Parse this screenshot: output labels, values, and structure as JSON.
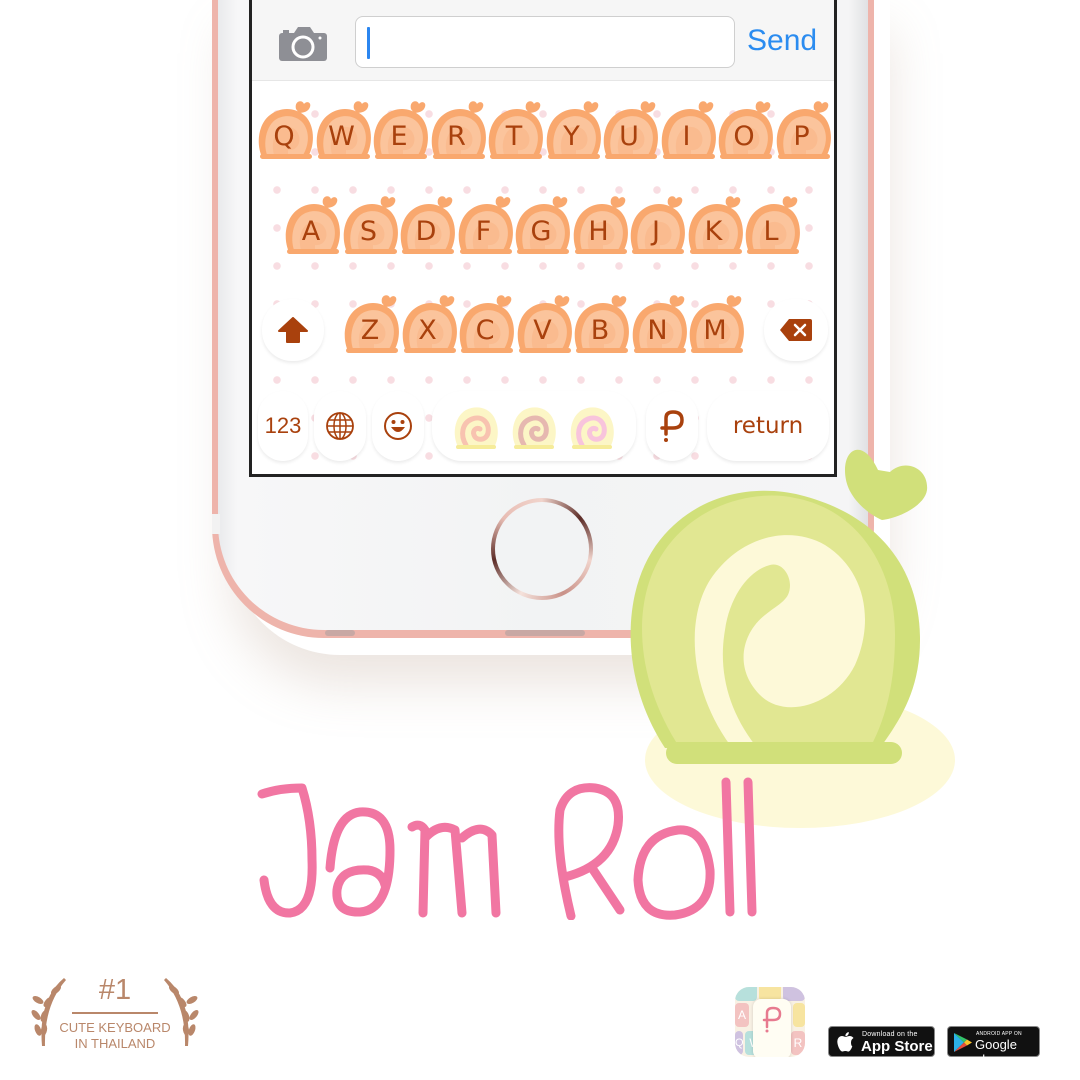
{
  "message_bar": {
    "camera_icon": "camera-icon",
    "input_value": "",
    "send_label": "Send"
  },
  "keyboard": {
    "row1": [
      "Q",
      "W",
      "E",
      "R",
      "T",
      "Y",
      "U",
      "I",
      "O",
      "P"
    ],
    "row2": [
      "A",
      "S",
      "D",
      "F",
      "G",
      "H",
      "J",
      "K",
      "L"
    ],
    "row3": [
      "Z",
      "X",
      "C",
      "V",
      "B",
      "N",
      "M"
    ],
    "shift_icon": "shift-arrow-icon",
    "backspace_icon": "backspace-icon",
    "numbers_label": "123",
    "globe_icon": "globe-icon",
    "emoji_icon": "smiley-icon",
    "theme_rolls": [
      "peach-roll",
      "chocolate-roll",
      "pink-roll"
    ],
    "logo_icon": "p-logo-icon",
    "return_label": "return",
    "colors": {
      "key_outer": "#f9a86e",
      "key_inner": "#fbc49c",
      "key_text": "#a9410d",
      "dot": "#f8dde2"
    }
  },
  "hero": {
    "title": "Jam Roll",
    "title_color": "#f176a2",
    "roll_colors": {
      "outer": "#d1e07a",
      "mid": "#e1e792",
      "cream": "#fdf9d8",
      "plate": "#fdf9d8"
    }
  },
  "badge": {
    "rank": "#1",
    "line1": "CUTE KEYBOARD",
    "line2": "IN THAILAND",
    "color": "#b9876a"
  },
  "stores": {
    "app_store_small": "Download on the",
    "app_store_big": "App Store",
    "google_small": "ANDROID APP ON",
    "google_big": "Google play"
  },
  "app_icon_letters": [
    "A",
    "W",
    "R",
    "Q"
  ]
}
